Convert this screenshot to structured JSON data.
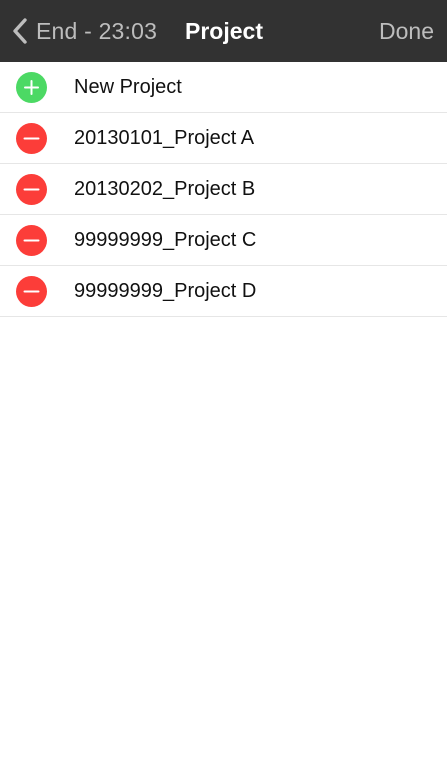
{
  "navbar": {
    "back_label": "End - 23:03",
    "title": "Project",
    "done_label": "Done"
  },
  "list": {
    "add_row": {
      "label": "New Project",
      "icon": "plus-circle-icon",
      "color": "#4cd964"
    },
    "items": [
      {
        "label": "20130101_Project A",
        "icon": "minus-circle-icon",
        "color": "#fc3d39"
      },
      {
        "label": "20130202_Project B",
        "icon": "minus-circle-icon",
        "color": "#fc3d39"
      },
      {
        "label": "99999999_Project C",
        "icon": "minus-circle-icon",
        "color": "#fc3d39"
      },
      {
        "label": "99999999_Project D",
        "icon": "minus-circle-icon",
        "color": "#fc3d39"
      }
    ]
  },
  "colors": {
    "navbar_background": "#323232",
    "navbar_inactive_text": "#bdbdbd",
    "navbar_title_text": "#ffffff"
  }
}
